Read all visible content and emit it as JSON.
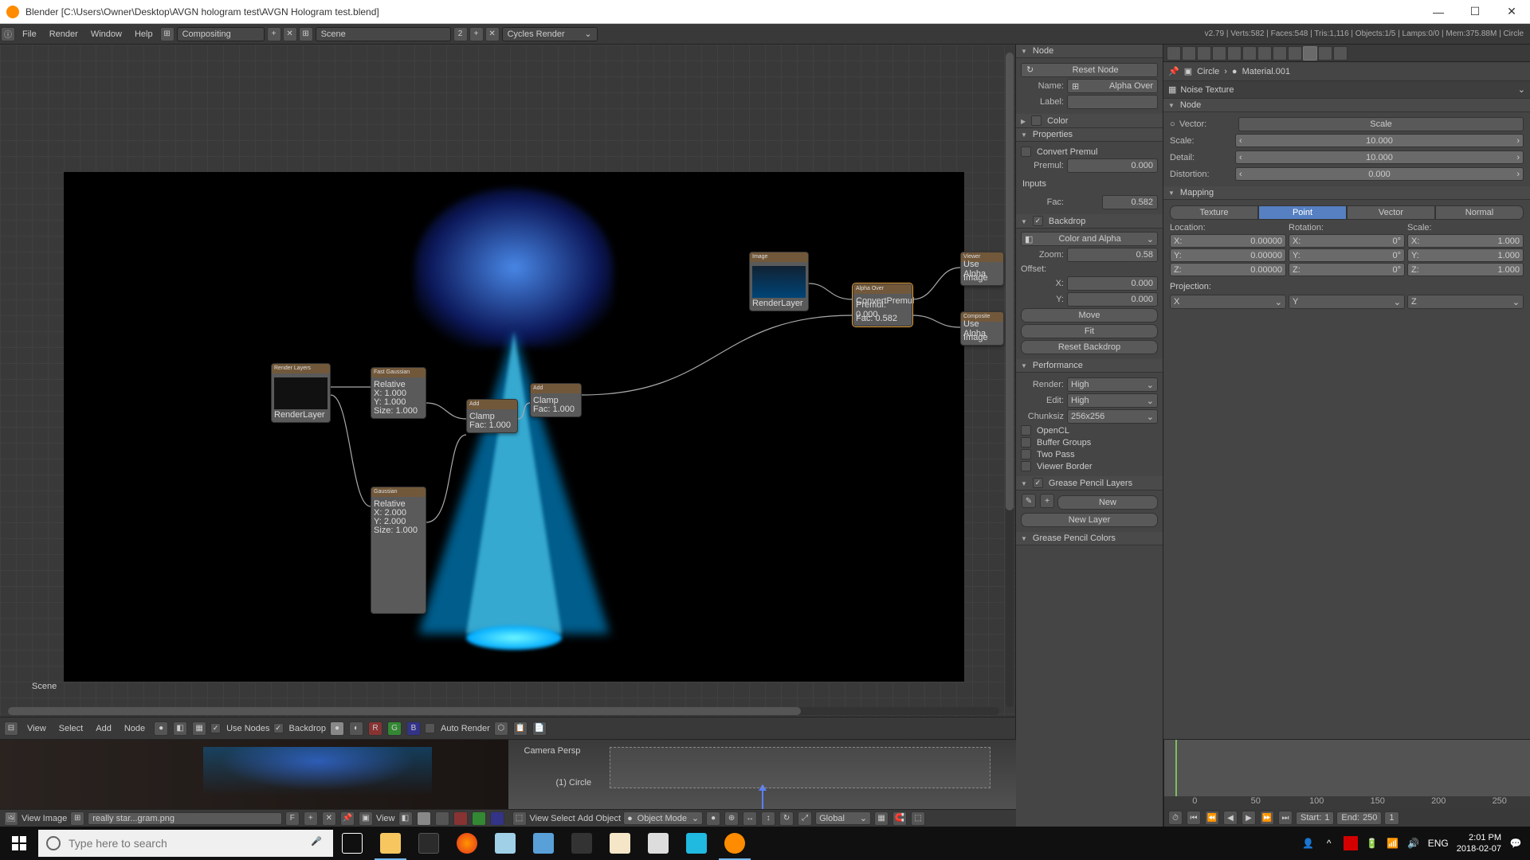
{
  "window": {
    "title": "Blender [C:\\Users\\Owner\\Desktop\\AVGN hologram test\\AVGN Hologram test.blend]"
  },
  "info": {
    "menus": [
      "File",
      "Render",
      "Window",
      "Help"
    ],
    "layout": "Compositing",
    "scene": "Scene",
    "engine": "Cycles Render",
    "stats": "v2.79 | Verts:582 | Faces:548 | Tris:1,116 | Objects:1/5 | Lamps:0/0 | Mem:375.88M | Circle"
  },
  "node_editor": {
    "scene_label": "Scene",
    "footer": {
      "menus": [
        "View",
        "Select",
        "Add",
        "Node"
      ],
      "use_nodes": "Use Nodes",
      "backdrop": "Backdrop",
      "auto_render": "Auto Render"
    },
    "nodes": {
      "render_layers": "Render Layers",
      "blur1": "Fast Gaussian",
      "blur2": "Gaussian",
      "mix1": "Add",
      "mix2": "Add",
      "alpha_over": "Alpha Over",
      "viewer": "Viewer",
      "composite": "Composite"
    }
  },
  "n_panel": {
    "node": {
      "header": "Node",
      "reset": "Reset Node",
      "name_label": "Name:",
      "name_value": "Alpha Over",
      "label_label": "Label:",
      "label_value": ""
    },
    "color": {
      "header": "Color"
    },
    "properties": {
      "header": "Properties",
      "convert_premul": "Convert Premul",
      "premul_label": "Premul:",
      "premul_value": "0.000"
    },
    "inputs": {
      "header": "Inputs",
      "fac_label": "Fac:",
      "fac_value": "0.582"
    },
    "backdrop": {
      "header": "Backdrop",
      "mode": "Color and Alpha",
      "zoom_label": "Zoom:",
      "zoom_value": "0.58",
      "offset_label": "Offset:",
      "x_label": "X:",
      "x_value": "0.000",
      "y_label": "Y:",
      "y_value": "0.000",
      "move": "Move",
      "fit": "Fit",
      "reset": "Reset Backdrop"
    },
    "performance": {
      "header": "Performance",
      "render_label": "Render:",
      "render_value": "High",
      "edit_label": "Edit:",
      "edit_value": "High",
      "chunk_label": "Chunksiz",
      "chunk_value": "256x256",
      "opencl": "OpenCL",
      "buffer_groups": "Buffer Groups",
      "two_pass": "Two Pass",
      "viewer_border": "Viewer Border"
    },
    "gp_layers": {
      "header": "Grease Pencil Layers",
      "new": "New",
      "new_layer": "New Layer"
    },
    "gp_colors": {
      "header": "Grease Pencil Colors"
    }
  },
  "r_panel": {
    "breadcrumb": {
      "obj": "Circle",
      "mat": "Material.001"
    },
    "texture": "Noise Texture",
    "node_header": "Node",
    "vector": {
      "label": "Vector:",
      "value": "Scale"
    },
    "scale": {
      "label": "Scale:",
      "value": "10.000"
    },
    "detail": {
      "label": "Detail:",
      "value": "10.000"
    },
    "distortion": {
      "label": "Distortion:",
      "value": "0.000"
    },
    "mapping": {
      "header": "Mapping",
      "tabs": [
        "Texture",
        "Point",
        "Vector",
        "Normal"
      ],
      "location": {
        "label": "Location:",
        "x": "0.00000",
        "y": "0.00000",
        "z": "0.00000"
      },
      "rotation": {
        "label": "Rotation:",
        "x": "0°",
        "y": "0°",
        "z": "0°"
      },
      "scale_col": {
        "label": "Scale:",
        "x": "1.000",
        "y": "1.000",
        "z": "1.000"
      },
      "projection": "Projection:",
      "proj_x": "X",
      "proj_y": "Y",
      "proj_z": "Z"
    }
  },
  "image_editor": {
    "menus": [
      "View",
      "Image"
    ],
    "filename": "really star...gram.png",
    "view2": "View"
  },
  "view3d": {
    "cam": "Camera Persp",
    "obj": "(1) Circle",
    "menus": [
      "View",
      "Select",
      "Add",
      "Object"
    ],
    "mode": "Object Mode",
    "orientation": "Global"
  },
  "timeline": {
    "ticks": [
      "0",
      "50",
      "100",
      "150",
      "200",
      "250"
    ],
    "start_label": "Start:",
    "start_value": "1",
    "end_label": "End:",
    "end_value": "250",
    "current": "1"
  },
  "taskbar": {
    "search_placeholder": "Type here to search",
    "lang": "ENG",
    "time": "2:01 PM",
    "date": "2018-02-07"
  }
}
